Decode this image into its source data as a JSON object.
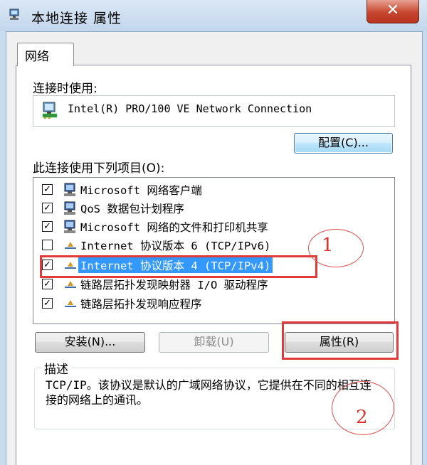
{
  "window": {
    "title": "本地连接 属性",
    "close_label": "✕"
  },
  "tabs": [
    {
      "label": "网络"
    }
  ],
  "connect_using": {
    "label": "连接时使用:",
    "adapter": "Intel(R) PRO/100 VE Network Connection",
    "configure_label": "配置(C)..."
  },
  "items_label": "此连接使用下列项目(O):",
  "items": [
    {
      "label": "Microsoft 网络客户端",
      "checked": true,
      "icon": "network-client-icon"
    },
    {
      "label": "QoS 数据包计划程序",
      "checked": true,
      "icon": "qos-scheduler-icon"
    },
    {
      "label": "Microsoft 网络的文件和打印机共享",
      "checked": true,
      "icon": "file-print-sharing-icon"
    },
    {
      "label": "Internet 协议版本 6 (TCP/IPv6)",
      "checked": false,
      "icon": "protocol-icon"
    },
    {
      "label": "Internet 协议版本 4 (TCP/IPv4)",
      "checked": true,
      "icon": "protocol-icon",
      "selected": true
    },
    {
      "label": "链路层拓扑发现映射器 I/O 驱动程序",
      "checked": true,
      "icon": "protocol-icon"
    },
    {
      "label": "链路层拓扑发现响应程序",
      "checked": true,
      "icon": "protocol-icon"
    }
  ],
  "buttons": {
    "install": "安装(N)...",
    "uninstall": "卸载(U)",
    "properties": "属性(R)"
  },
  "description": {
    "title": "描述",
    "text": "TCP/IP。该协议是默认的广域网络协议，它提供在不同的相互连接的网络上的通讯。"
  },
  "annotations": {
    "marker_1": "1",
    "marker_2": "2"
  },
  "colors": {
    "selection": "#3399ff",
    "annotation": "#e23a3a"
  }
}
